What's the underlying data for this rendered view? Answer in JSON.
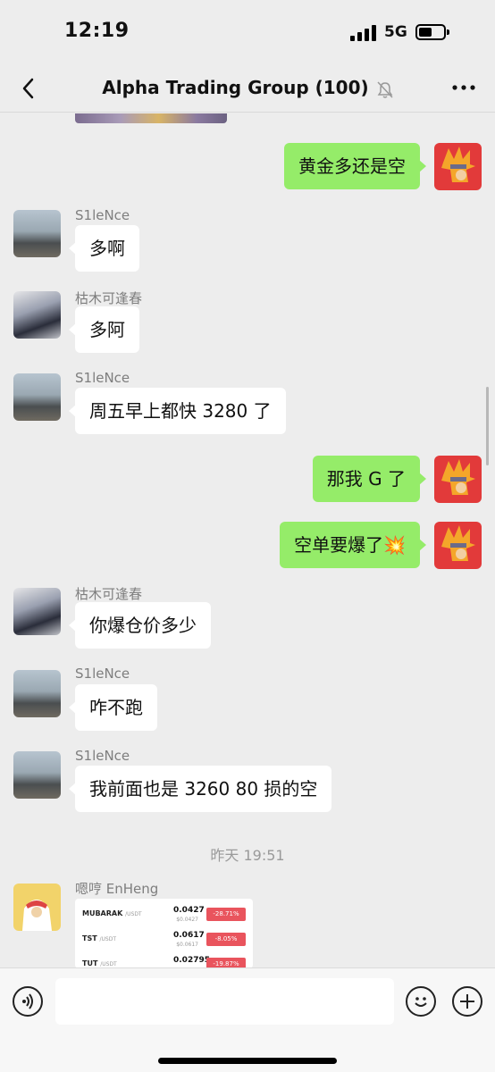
{
  "status_bar": {
    "time": "12:19",
    "network": "5G"
  },
  "header": {
    "title": "Alpha Trading Group (100)"
  },
  "messages": [
    {
      "sender": "",
      "text": "黄金多还是空",
      "side": "out"
    },
    {
      "sender": "S1leNce",
      "text": "多啊",
      "side": "in"
    },
    {
      "sender": "枯木可逢春",
      "text": "多阿",
      "side": "in"
    },
    {
      "sender": "S1leNce",
      "text": "周五早上都快 3280 了",
      "side": "in"
    },
    {
      "sender": "",
      "text": "那我 G 了",
      "side": "out"
    },
    {
      "sender": "",
      "text": "空单要爆了💥",
      "side": "out"
    },
    {
      "sender": "枯木可逢春",
      "text": "你爆仓价多少",
      "side": "in"
    },
    {
      "sender": "S1leNce",
      "text": "咋不跑",
      "side": "in"
    },
    {
      "sender": "S1leNce",
      "text": "我前面也是 3260 80 损的空",
      "side": "in"
    }
  ],
  "timestamp": "昨天 19:51",
  "last_message": {
    "sender": "嗯哼 EnHeng",
    "tickers": [
      {
        "symbol": "MUBARAK",
        "quote": "/USDT",
        "price": "0.0427",
        "sub_price": "$0.0427",
        "change": "-28.71%"
      },
      {
        "symbol": "TST",
        "quote": "/USDT",
        "price": "0.0617",
        "sub_price": "$0.0617",
        "change": "-8.05%"
      },
      {
        "symbol": "TUT",
        "quote": "/USDT",
        "price": "0.02795",
        "sub_price": "",
        "change": "-19.87%"
      }
    ]
  },
  "icons": {
    "back": "chevron-left-icon",
    "mute": "bell-off-icon",
    "more": "ellipsis-icon",
    "voice": "voice-icon",
    "emoji": "smiley-icon",
    "plus": "plus-icon"
  },
  "colors": {
    "background": "#ededed",
    "outgoing_bubble": "#95ec69",
    "incoming_bubble": "#ffffff",
    "change_badge": "#e9545d"
  }
}
